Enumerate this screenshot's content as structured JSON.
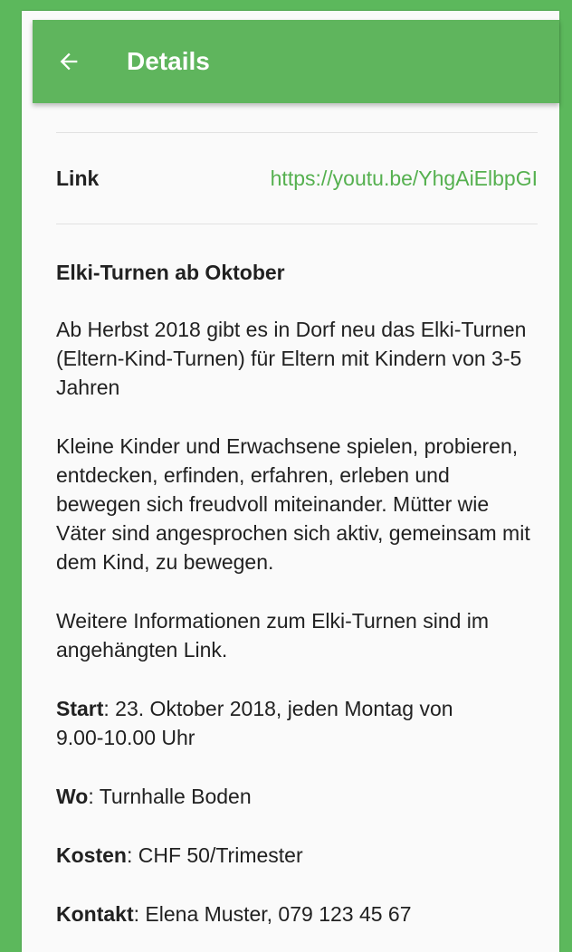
{
  "appbar": {
    "back_icon": "arrow-left-icon",
    "title": "Details",
    "color": "#5fb55d"
  },
  "link": {
    "label": "Link",
    "value": "https://youtu.be/YhgAiElbpGI",
    "color": "#55b04f"
  },
  "post": {
    "heading": "Elki-Turnen ab Oktober",
    "paragraphs": [
      "Ab Herbst 2018 gibt es in Dorf neu das Elki-Turnen (Eltern-Kind-Turnen) für Eltern mit Kindern von 3-5 Jahren",
      "Kleine Kinder und Erwachsene spielen, probieren, entdecken, erfinden, erfahren, erleben und bewegen sich freudvoll miteinander. Mütter wie Väter sind angesprochen sich aktiv, gemeinsam mit dem Kind, zu bewegen.",
      "Weitere Informationen zum Elki-Turnen sind im angehängten Link."
    ],
    "start_label": "Start",
    "start_value": ": 23. Oktober 2018, jeden Montag von 9.00-10.00 Uhr",
    "where_label": "Wo",
    "where_value": ": Turnhalle Boden",
    "cost_label": "Kosten",
    "cost_value": ": CHF 50/Trimester",
    "contact_label": "Kontakt",
    "contact_value": ": Elena Muster, 079 123 45 67"
  }
}
